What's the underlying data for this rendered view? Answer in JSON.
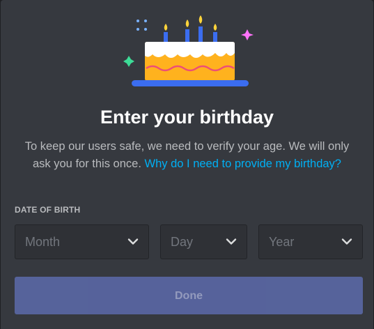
{
  "modal": {
    "title": "Enter your birthday",
    "description": "To keep our users safe, we need to verify your age. We will only ask you for this once. ",
    "help_link": "Why do I need to provide my birthday?",
    "dob_label": "DATE OF BIRTH",
    "selects": {
      "month_placeholder": "Month",
      "day_placeholder": "Day",
      "year_placeholder": "Year"
    },
    "done_label": "Done",
    "done_enabled": false
  },
  "icons": {
    "illustration": "birthday-cake-icon",
    "dropdown": "chevron-down-icon"
  },
  "colors": {
    "background": "#36393f",
    "link": "#00b0f4",
    "button": "#5865a0",
    "input": "#2f3136"
  }
}
